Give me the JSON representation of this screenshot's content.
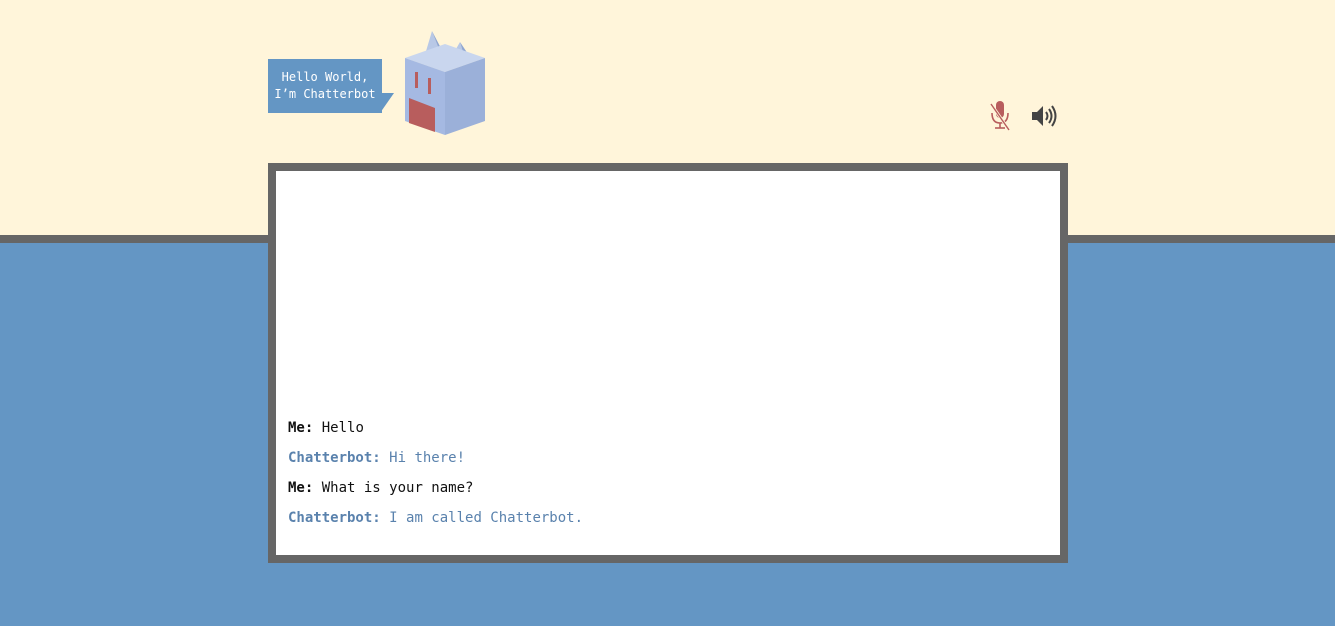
{
  "bubble": {
    "line1": "Hello World,",
    "line2": "I’m Chatterbot"
  },
  "controls": {
    "mic_icon": "microphone-muted-icon",
    "speaker_icon": "speaker-on-icon"
  },
  "colors": {
    "top_background": "#fff5da",
    "bottom_background": "#6496c4",
    "frame": "#666666",
    "bot_text": "#5a82ad",
    "mic_muted": "#b85d5d"
  },
  "messages": [
    {
      "speaker": "Me:",
      "text": "Hello",
      "role": "user"
    },
    {
      "speaker": "Chatterbot:",
      "text": "Hi there!",
      "role": "bot"
    },
    {
      "speaker": "Me:",
      "text": "What is your name?",
      "role": "user"
    },
    {
      "speaker": "Chatterbot:",
      "text": "I am called Chatterbot.",
      "role": "bot"
    }
  ]
}
